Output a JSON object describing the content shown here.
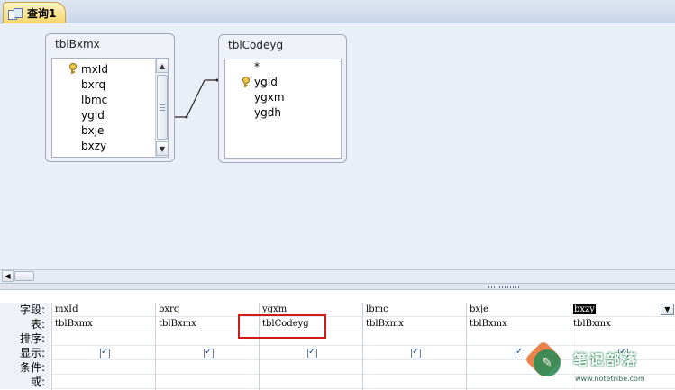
{
  "tab": {
    "label": "查询1"
  },
  "tables": {
    "left": {
      "title": "tblBxmx",
      "fields": [
        "mxId",
        "bxrq",
        "lbmc",
        "ygId",
        "bxje",
        "bxzy"
      ]
    },
    "right": {
      "title": "tblCodeyg",
      "fields": [
        "*",
        "ygId",
        "ygxm",
        "ygdh"
      ]
    }
  },
  "grid": {
    "row_labels": [
      "字段:",
      "表:",
      "排序:",
      "显示:",
      "条件:",
      "或:"
    ],
    "columns": [
      {
        "field": "mxId",
        "table": "tblBxmx",
        "show": true
      },
      {
        "field": "bxrq",
        "table": "tblBxmx",
        "show": true
      },
      {
        "field": "ygxm",
        "table": "tblCodeyg",
        "show": true
      },
      {
        "field": "lbmc",
        "table": "tblBxmx",
        "show": true
      },
      {
        "field": "bxje",
        "table": "tblBxmx",
        "show": true
      },
      {
        "field": "bxzy",
        "table": "tblBxmx",
        "show": true
      }
    ]
  },
  "watermark": {
    "title": "笔记部落",
    "url": "www.notetribe.com"
  },
  "colors": {
    "highlight": "#d11b1b",
    "tab_active": "#f6d66a",
    "pane_bg": "#eaeef6"
  }
}
